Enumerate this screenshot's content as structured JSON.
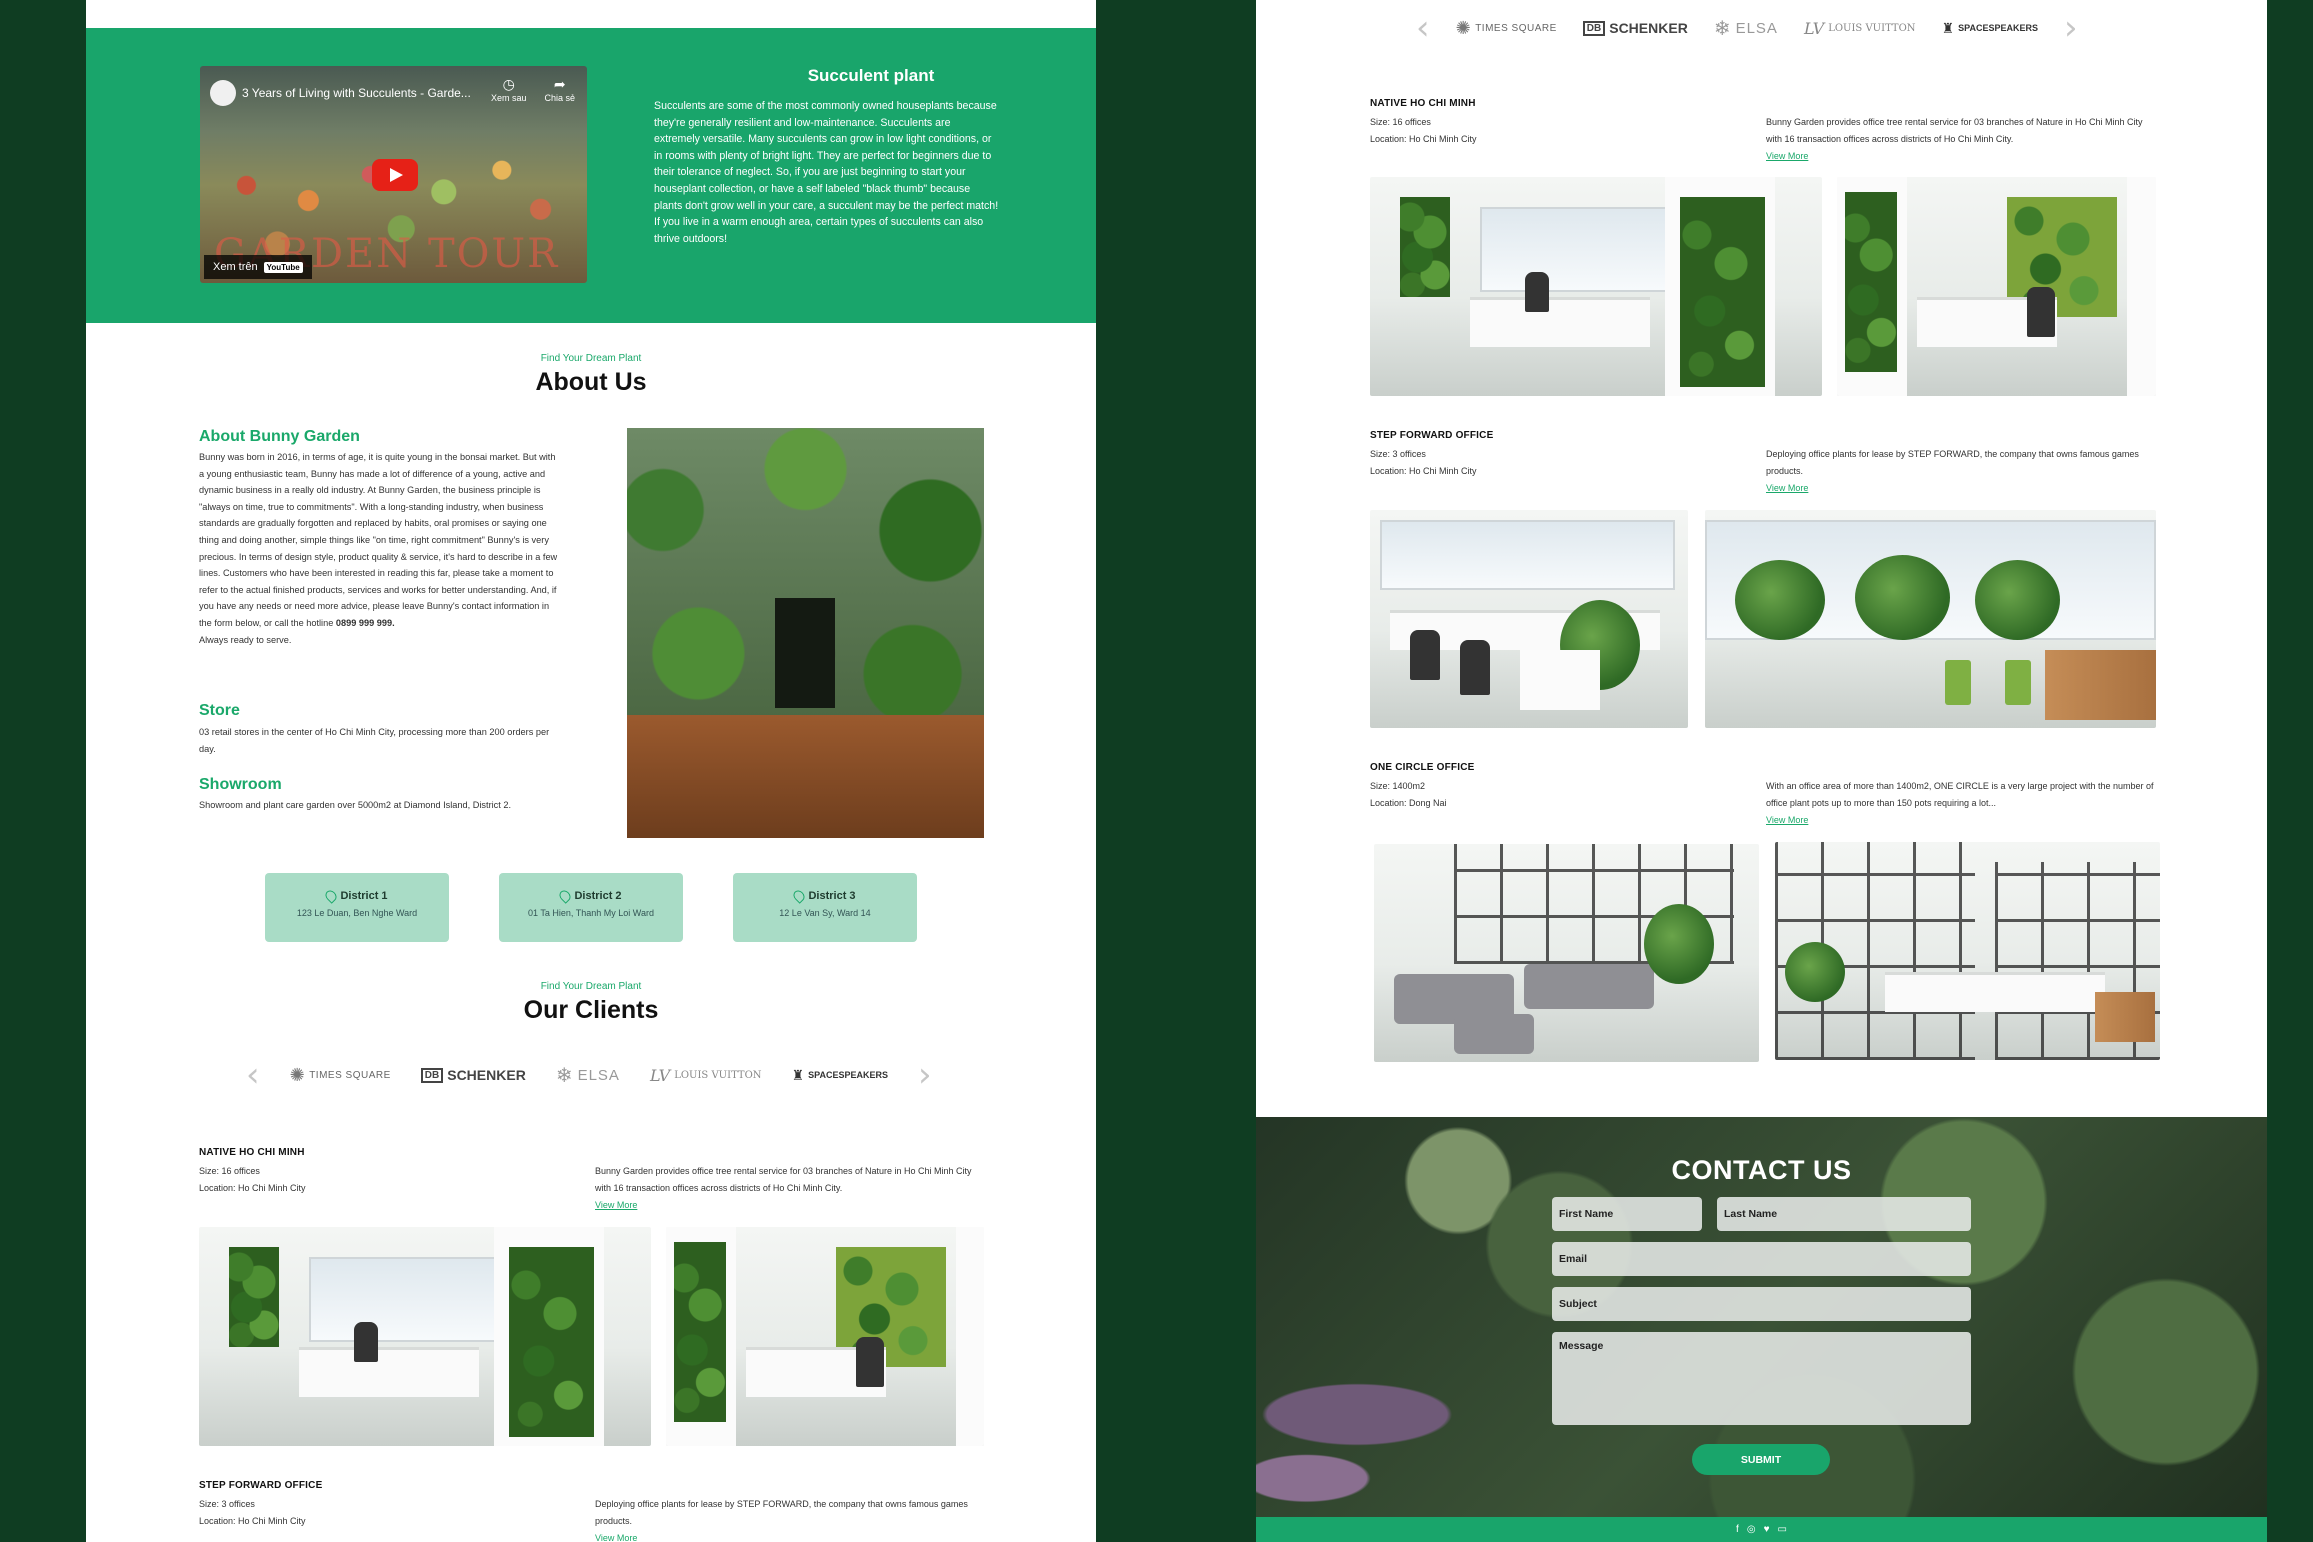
{
  "hero": {
    "video_title": "3 Years of Living with Succulents - Garde...",
    "video_actions": [
      {
        "icon": "clock-icon",
        "label": "Xem sau"
      },
      {
        "icon": "share-icon",
        "label": "Chia sẻ"
      }
    ],
    "watch_on": "Xem trên",
    "watch_brand": "YouTube",
    "video_overlay_text": "GARDEN TOUR",
    "title": "Succulent plant",
    "text": "Succulents are some of the most commonly owned houseplants because they're generally resilient and low-maintenance. Succulents are extremely versatile. Many succulents can grow in low light conditions, or in rooms with plenty of bright light. They are perfect for beginners due to their tolerance of neglect. So, if you are just beginning to start your houseplant collection, or have a self labeled \"black thumb\" because plants don't grow well in your care, a succulent may be the perfect match! If you live in a warm enough area, certain types of succulents can also thrive outdoors!"
  },
  "about": {
    "eyebrow": "Find Your Dream Plant",
    "title": "About Us",
    "bunny_title": "About Bunny Garden",
    "bunny_text": "Bunny was born in 2016, in terms of age, it is quite young in the bonsai market. But with a young enthusiastic team, Bunny has made a lot of difference of a young, active and dynamic business in a really old industry. At Bunny Garden, the business principle is \"always on time, true to commitments\". With a long-standing industry, when business standards are gradually forgotten and replaced by habits, oral promises or saying one thing and doing another, simple things like \"on time, right commitment\" Bunny's is very precious. In terms of design style, product quality & service, it's hard to describe in a few lines. Customers who have been interested in reading this far, please take a moment to refer to the actual finished products, services and works for better understanding. And, if you have any needs or need more advice, please leave Bunny's contact information in the form below, or call the hotline",
    "hotline": "0899 999 999.",
    "closing": "Always ready to serve.",
    "store_title": "Store",
    "store_text": "03 retail stores in the center of Ho Chi Minh City, processing more than 200 orders per day.",
    "showroom_title": "Showroom",
    "showroom_text": "Showroom and plant care garden over 5000m2 at Diamond Island, District 2."
  },
  "districts": [
    {
      "name": "District 1",
      "address": "123 Le Duan, Ben Nghe Ward"
    },
    {
      "name": "District 2",
      "address": "01 Ta Hien, Thanh My Loi Ward"
    },
    {
      "name": "District 3",
      "address": "12 Le Van Sy, Ward 14"
    }
  ],
  "clients": {
    "eyebrow": "Find Your Dream Plant",
    "title": "Our Clients",
    "logos": [
      "TIMES SQUARE",
      "DB",
      "SCHENKER",
      "ELSA",
      "LOUIS VUITTON",
      "SPACESPEAKERS"
    ],
    "prev_arrow": "‹",
    "next_arrow": "›"
  },
  "projects": [
    {
      "name": "NATIVE HO CHI MINH",
      "size": "Size: 16 offices",
      "location": "Location: Ho Chi Minh City",
      "desc": "Bunny Garden provides office tree rental service for 03 branches of Nature in Ho Chi Minh City with 16 transaction offices across districts of Ho Chi Minh City.",
      "view_more": "View More"
    },
    {
      "name": "STEP FORWARD OFFICE",
      "size": "Size: 3 offices",
      "location": "Location: Ho Chi Minh City",
      "desc": "Deploying office plants for lease by STEP FORWARD, the company that owns famous games products.",
      "view_more": "View More"
    },
    {
      "name": "ONE CIRCLE OFFICE",
      "size": "Size: 1400m2",
      "location": "Location: Dong Nai",
      "desc": "With an office area of more than 1400m2, ONE CIRCLE is a very large project with the number of office plant pots up to more than 150 pots requiring a lot...",
      "view_more": "View More"
    }
  ],
  "contact": {
    "title": "CONTACT US",
    "first_name": "First Name",
    "last_name": "Last Name",
    "email": "Email",
    "subject": "Subject",
    "message": "Message",
    "submit": "SUBMIT"
  },
  "footer": {
    "social": [
      "f",
      "◎",
      "♥",
      "▭"
    ]
  },
  "colors": {
    "brand_green": "#19a56b",
    "background": "#0f3d22",
    "district_card": "#a9dcc6"
  }
}
